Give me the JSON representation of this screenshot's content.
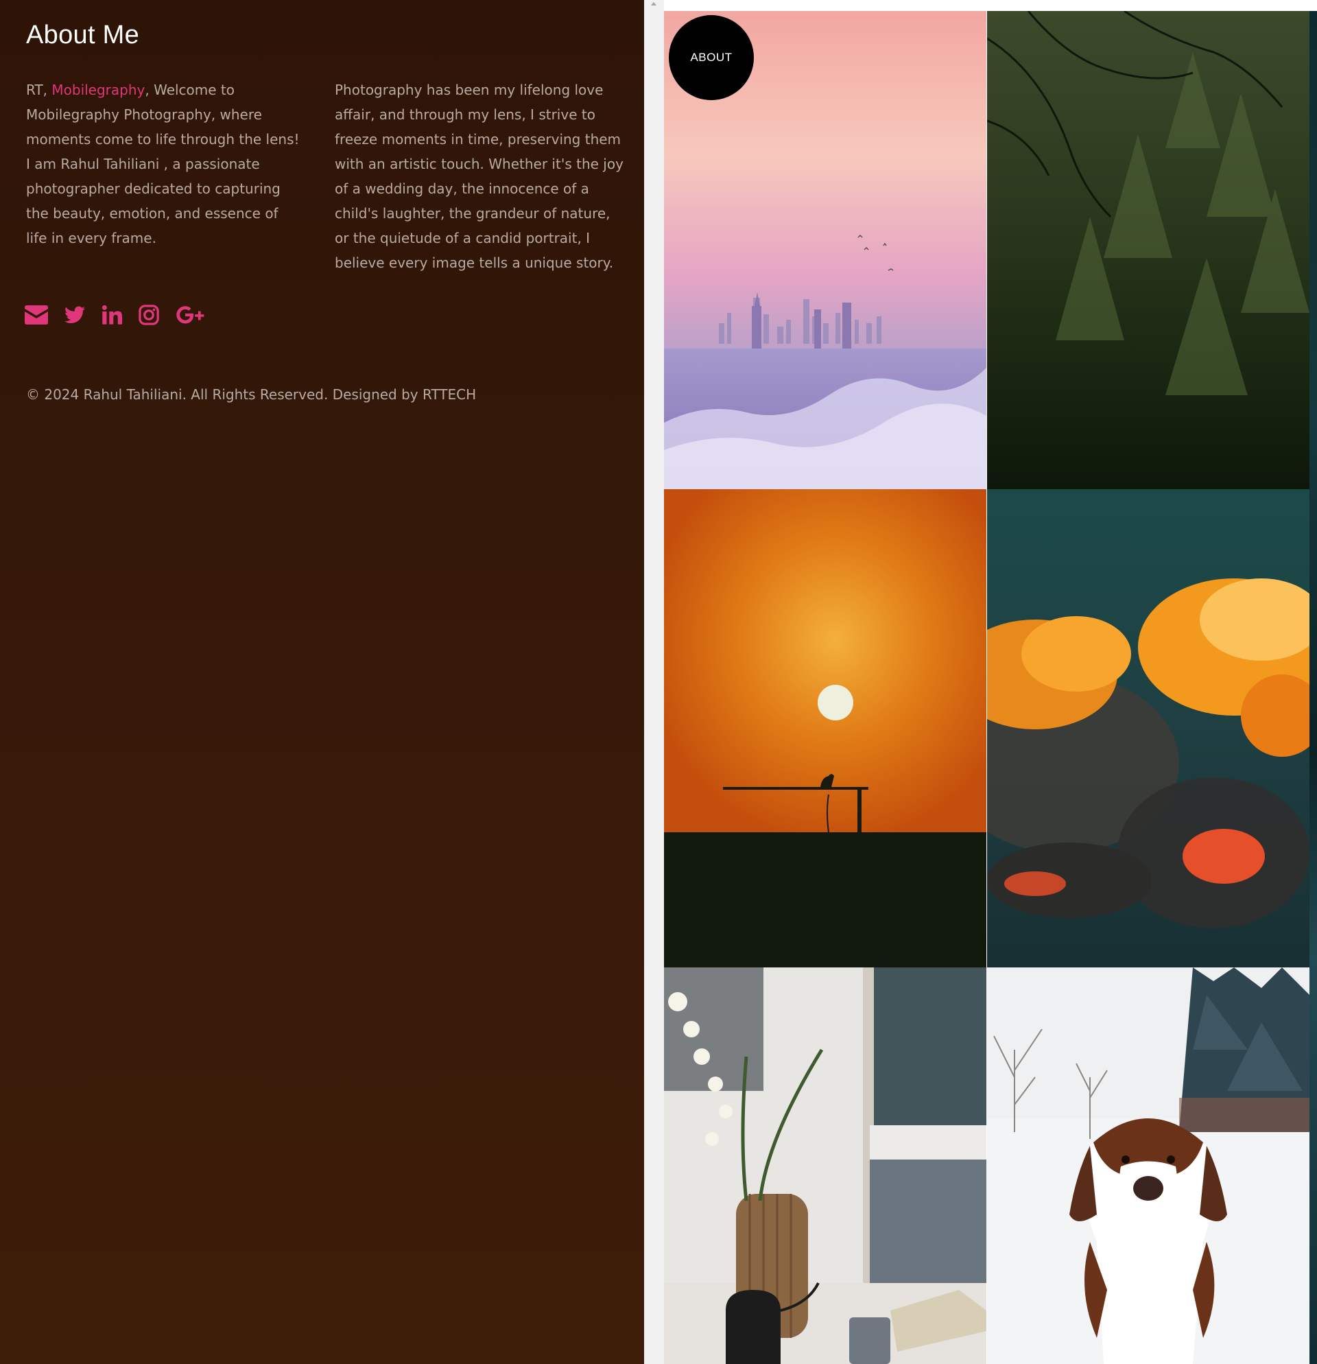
{
  "about": {
    "title": "About Me",
    "col1_prefix": "RT, ",
    "col1_brand": "Mobilegraphy",
    "col1_rest": ", Welcome to Mobilegraphy Photography, where moments come to life through the lens! I am Rahul Tahiliani , a passionate photographer dedicated to capturing the beauty, emotion, and essence of life in every frame.",
    "col2": "Photography has been my lifelong love affair, and through my lens, I strive to freeze moments in time, preserving them with an artistic touch. Whether it's the joy of a wedding day, the innocence of a child's laughter, the grandeur of nature, or the quietude of a candid portrait, I believe every image tells a unique story.",
    "copyright": "© 2024 Rahul Tahiliani. All Rights Reserved. Designed by RTTECH"
  },
  "socials": [
    {
      "icon": "envelope-icon"
    },
    {
      "icon": "twitter-icon"
    },
    {
      "icon": "linkedin-icon"
    },
    {
      "icon": "instagram-icon"
    },
    {
      "icon": "google-plus-icon"
    }
  ],
  "badge": {
    "label": "ABOUT"
  },
  "colors": {
    "accent": "#e0367a",
    "panel_bg": "#2e1407",
    "body_text": "#b9aba3"
  }
}
